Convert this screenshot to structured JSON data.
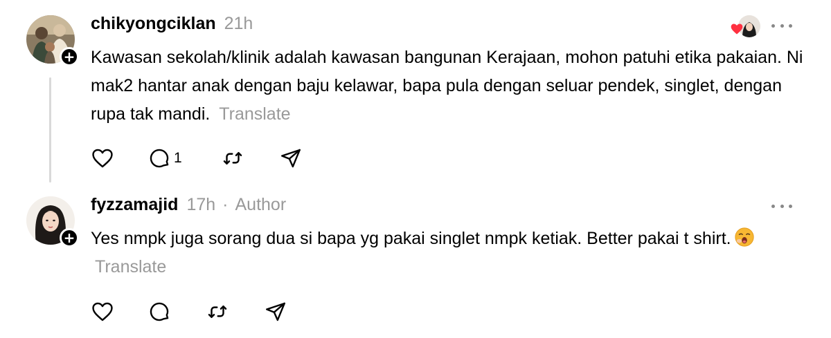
{
  "posts": [
    {
      "username": "chikyongciklan",
      "timestamp": "21h",
      "text": "Kawasan sekolah/klinik adalah kawasan bangunan Kerajaan, mohon patuhi etika pakaian. Ni mak2 hantar anak dengan baju kelawar, bapa pula dengan seluar pendek, singlet, dengan rupa tak mandi.",
      "translate_label": "Translate",
      "reply_count": "1",
      "liked_by_heart_color": "#ff3040"
    },
    {
      "username": "fyzzamajid",
      "timestamp": "17h",
      "separator": "·",
      "author_label": "Author",
      "text": "Yes nmpk juga sorang dua si bapa yg pakai singlet nmpk ketiak. Better pakai t shirt.",
      "emoji": "yawning-face-emoji",
      "translate_label": "Translate"
    }
  ],
  "icons": {
    "like": "heart-outline-icon",
    "reply": "speech-bubble-icon",
    "repost": "repost-arrows-icon",
    "share": "paper-plane-icon",
    "more": "more-dots-icon",
    "follow": "plus-badge-icon"
  },
  "colors": {
    "text": "#000000",
    "muted": "#999999",
    "thread_line": "#d9d9d9",
    "like_heart": "#ff3040"
  }
}
